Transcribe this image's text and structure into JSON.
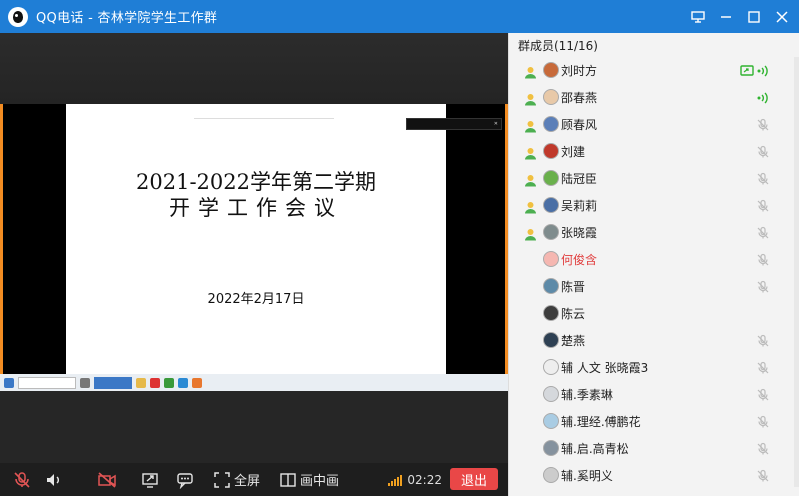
{
  "window": {
    "title": "QQ电话 - 杏林学院学生工作群",
    "icons": [
      "qq-logo-icon",
      "present-icon",
      "minimize-icon",
      "maximize-icon",
      "close-icon"
    ]
  },
  "slide": {
    "title_line1": "2021-2022学年第二学期",
    "title_line2": "开学工作会议",
    "date": "2022年2月17日"
  },
  "toolbar": {
    "fullscreen_label": "全屏",
    "pip_label": "画中画",
    "timer": "02:22",
    "exit_label": "退出",
    "accent_color": "#e94747"
  },
  "members": {
    "header": "群成员(11/16)",
    "list": [
      {
        "name": "刘时方",
        "has_person_icon": true,
        "status": "speaking",
        "screen_share": true
      },
      {
        "name": "邵春燕",
        "has_person_icon": true,
        "status": "speaking"
      },
      {
        "name": "顾春风",
        "has_person_icon": true,
        "status": "muted"
      },
      {
        "name": "刘建",
        "has_person_icon": true,
        "status": "muted"
      },
      {
        "name": "陆冠臣",
        "has_person_icon": true,
        "status": "muted"
      },
      {
        "name": "吴莉莉",
        "has_person_icon": true,
        "status": "muted"
      },
      {
        "name": "张晓霞",
        "has_person_icon": true,
        "status": "muted"
      },
      {
        "name": "何俊含",
        "has_person_icon": false,
        "status": "muted",
        "highlight": true
      },
      {
        "name": "陈晋",
        "has_person_icon": false,
        "status": "muted"
      },
      {
        "name": "陈云",
        "has_person_icon": false,
        "status": "none"
      },
      {
        "name": "楚燕",
        "has_person_icon": false,
        "status": "muted"
      },
      {
        "name": "辅 人文 张晓霞3",
        "has_person_icon": false,
        "status": "muted"
      },
      {
        "name": "辅.季素琳",
        "has_person_icon": false,
        "status": "muted"
      },
      {
        "name": "辅.理经.傅鹏花",
        "has_person_icon": false,
        "status": "muted"
      },
      {
        "name": "辅.启.高青松",
        "has_person_icon": false,
        "status": "muted"
      },
      {
        "name": "辅.奚明义",
        "has_person_icon": false,
        "status": "muted"
      }
    ]
  }
}
